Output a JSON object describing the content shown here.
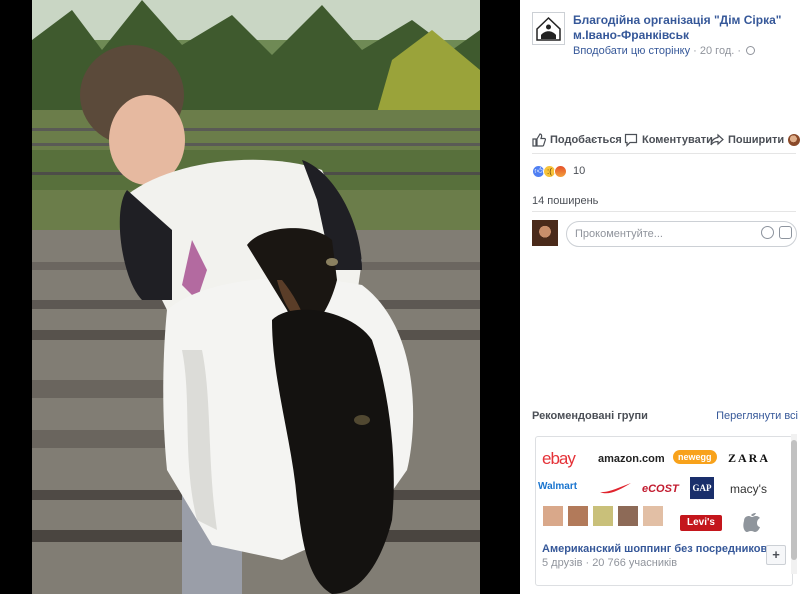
{
  "post": {
    "page_name": "Благодійна організація \"Дім Сірка\" м.Івано-Франківськ",
    "like_page": "Вподобати цю сторінку",
    "separator": "·",
    "time": "20 год.",
    "globe_icon": "globe-icon"
  },
  "actions": {
    "like": "Подобається",
    "comment": "Коментувати",
    "share": "Поширити"
  },
  "reactions": {
    "types": [
      "like",
      "sad",
      "angry"
    ],
    "count": "10"
  },
  "shares": "14 поширень",
  "comment_box": {
    "placeholder": "Прокоментуйте..."
  },
  "recommended": {
    "heading": "Рекомендовані групи",
    "see_all": "Переглянути всі",
    "brands": [
      "ebay",
      "amazon.com",
      "newegg",
      "ZARA",
      "Walmart",
      "eCOST",
      "GAP",
      "macy's",
      "Levi's"
    ],
    "group_name": "Американский шоппинг без посредников",
    "group_meta": "5 друзів · 20 766 учасників",
    "join_label": "+"
  },
  "colors": {
    "link": "#365899",
    "text": "#4b4f56",
    "muted": "#90949c",
    "border": "#dddfe2"
  }
}
